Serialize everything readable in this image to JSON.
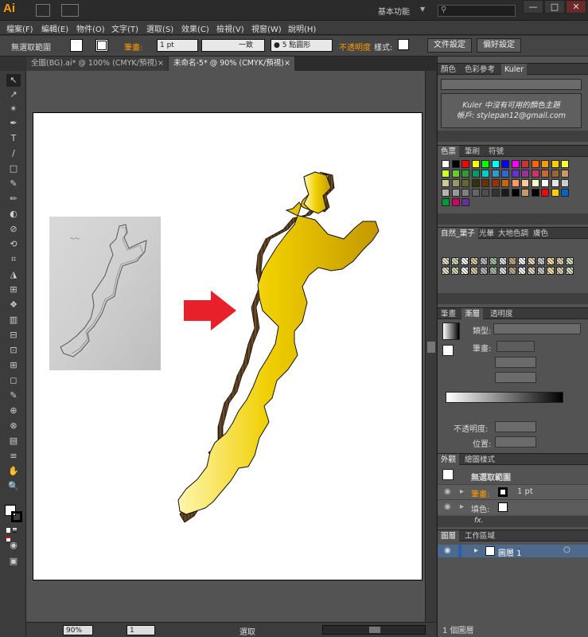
{
  "app": {
    "logo": "Ai",
    "workspace": "基本功能",
    "win_controls": [
      "—",
      "□",
      "✕"
    ]
  },
  "menu": [
    "檔案(F)",
    "編輯(E)",
    "物件(O)",
    "文字(T)",
    "選取(S)",
    "效果(C)",
    "檢視(V)",
    "視窗(W)",
    "說明(H)"
  ],
  "control_bar": {
    "selection": "無選取範圍",
    "stroke_label": "筆畫:",
    "stroke_width": "1 pt",
    "stroke_profile": "一致",
    "brush": "● 5 點圓形",
    "opacity_label": "不透明度",
    "style_label": "樣式:",
    "doc_setup": "文件設定",
    "prefs": "偏好設定"
  },
  "doc_tabs": [
    {
      "label": "全圖(BG).ai* @ 100% (CMYK/預視)",
      "close": "×"
    },
    {
      "label": "未命名-5* @ 90% (CMYK/預視)",
      "close": "×"
    }
  ],
  "tools": [
    "↖",
    "↗",
    "✴",
    "✒",
    "T",
    "/",
    "□",
    "✎",
    "✏",
    "◐",
    "⊘",
    "⟲",
    "⌗",
    "◮",
    "⊞",
    "❖",
    "▥",
    "⊟",
    "⊡",
    "⊞",
    "◻",
    "✎",
    "⊕",
    "⊗",
    "▤",
    "≡",
    "✋",
    "🔍"
  ],
  "panels": {
    "color_tabs": [
      "顏色",
      "色彩參考",
      "Kuler"
    ],
    "kuler_line1": "Kuler 中沒有可用的顏色主題",
    "kuler_line2": "帳戶: stylepan12@gmail.com",
    "swatch_tabs": [
      "色票",
      "筆刷",
      "符號"
    ],
    "pattern_tabs": [
      "自然_葉子",
      "光暈",
      "大地色調",
      "膚色"
    ],
    "stroke_tabs": [
      "筆畫",
      "漸層",
      "透明度"
    ],
    "gradient_type_label": "類型:",
    "gradient_stroke_label": "筆畫:",
    "opacity_label": "不透明度:",
    "position_label": "位置:",
    "appearance_tabs": [
      "外觀",
      "繪圖樣式"
    ],
    "appearance_title": "無選取範圍",
    "appearance_stroke": "筆畫:",
    "appearance_stroke_value": "1 pt",
    "appearance_fill": "填色:",
    "fx_label": "fx.",
    "layers_tabs": [
      "圖層",
      "工作區域"
    ],
    "layer_name": "圖層 1",
    "layers_count": "1 個圖層"
  },
  "status": {
    "zoom": "90%",
    "page": "1",
    "mode": "選取"
  },
  "swatch_colors": [
    "#ffffff",
    "#000000",
    "#ff0000",
    "#ffff00",
    "#00ff00",
    "#00ffff",
    "#0000ff",
    "#ff00ff",
    "#cc3333",
    "#ff6600",
    "#ff9900",
    "#ffcc00",
    "#ffff33",
    "#ccff33",
    "#66cc33",
    "#339933",
    "#009966",
    "#00cccc",
    "#3399cc",
    "#3366cc",
    "#6633cc",
    "#993399",
    "#cc3366",
    "#cc6633",
    "#996633",
    "#cc9966",
    "#cccc99",
    "#999966",
    "#666633",
    "#333300",
    "#663300",
    "#993300",
    "#cc6600",
    "#ff9966",
    "#ffcc99",
    "#ffffcc",
    "#ffffff",
    "#e6e6e6",
    "#cccccc",
    "#b3b3b3",
    "#999999",
    "#808080",
    "#666666",
    "#4d4d4d",
    "#333333",
    "#1a1a1a",
    "#000000",
    "#c49a6c",
    "#000000",
    "#ff0000",
    "#ffcc00",
    "#0066cc",
    "#009933",
    "#cc0066",
    "#663399"
  ],
  "accent_colors": {
    "orange": "#ff9a00",
    "map_yellow": "#e6c200",
    "arrow_red": "#e8202a",
    "layer_blue": "#4a6fa5"
  }
}
